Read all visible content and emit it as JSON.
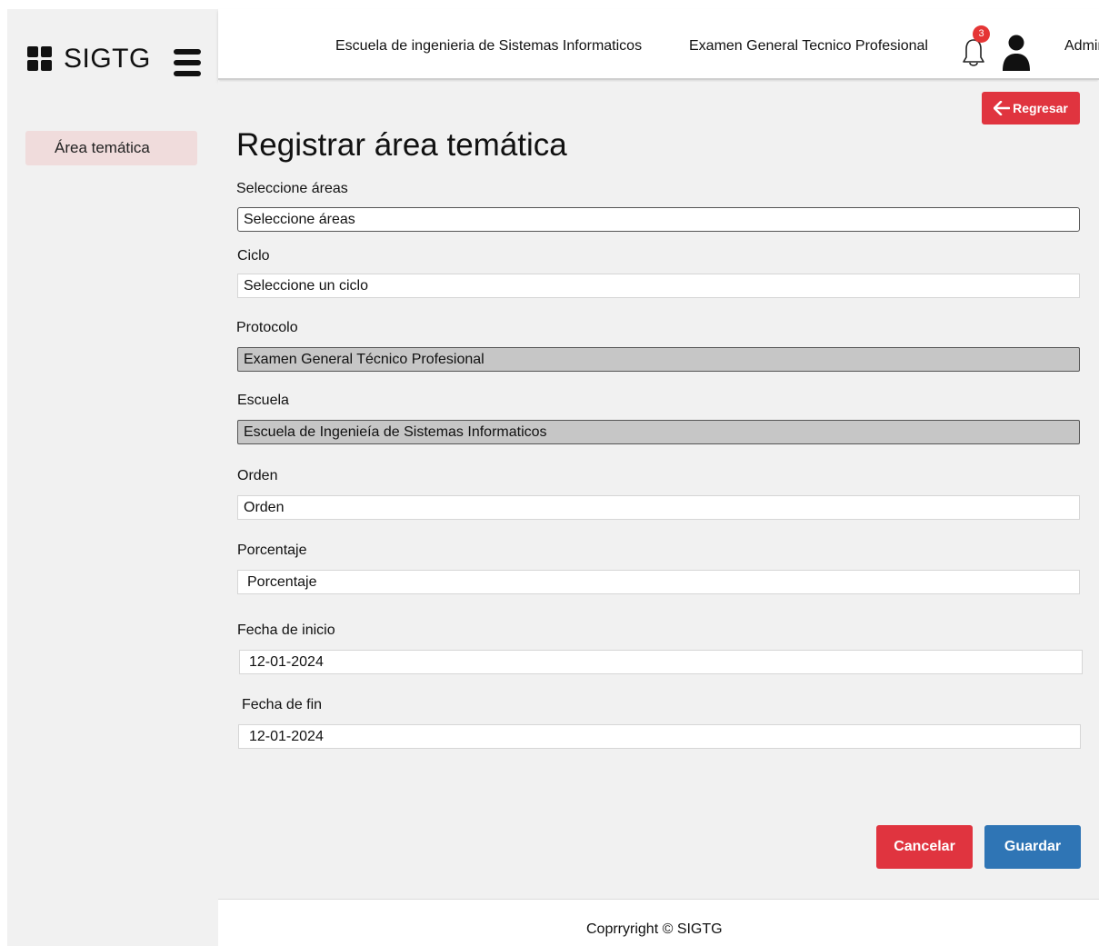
{
  "app": {
    "brand": "SIGTG"
  },
  "sidebar": {
    "items": [
      {
        "label": "Área temática"
      }
    ]
  },
  "header": {
    "school": "Escuela de ingenieria de Sistemas Informaticos",
    "exam": "Examen General Tecnico Profesional",
    "notifications_count": "3",
    "user": "Admin"
  },
  "page": {
    "back_label": "Regresar",
    "title": "Registrar área temática"
  },
  "form": {
    "areas": {
      "label": "Seleccione áreas",
      "placeholder": "Seleccione áreas"
    },
    "ciclo": {
      "label": "Ciclo",
      "placeholder": "Seleccione un ciclo"
    },
    "protocolo": {
      "label": "Protocolo",
      "value": "Examen General Técnico Profesional"
    },
    "escuela": {
      "label": "Escuela",
      "value": "Escuela de Ingenieía de Sistemas Informaticos"
    },
    "orden": {
      "label": "Orden",
      "placeholder": "Orden"
    },
    "porcentaje": {
      "label": "Porcentaje",
      "placeholder": "Porcentaje"
    },
    "fecha_inicio": {
      "label": "Fecha de inicio",
      "value": "12-01-2024"
    },
    "fecha_fin": {
      "label": "Fecha de fin",
      "value": "12-01-2024"
    }
  },
  "actions": {
    "cancel": "Cancelar",
    "save": "Guardar"
  },
  "footer": {
    "copyright": "Coprryright © SIGTG"
  },
  "colors": {
    "danger": "#e0343f",
    "primary": "#2f75b5",
    "active_item_bg": "#f0dcdc",
    "badge": "#e53535"
  },
  "icons": {
    "brand": "grid-icon",
    "menu": "hamburger-icon",
    "notifications": "bell-icon",
    "user": "user-icon",
    "back": "arrow-left-icon"
  }
}
